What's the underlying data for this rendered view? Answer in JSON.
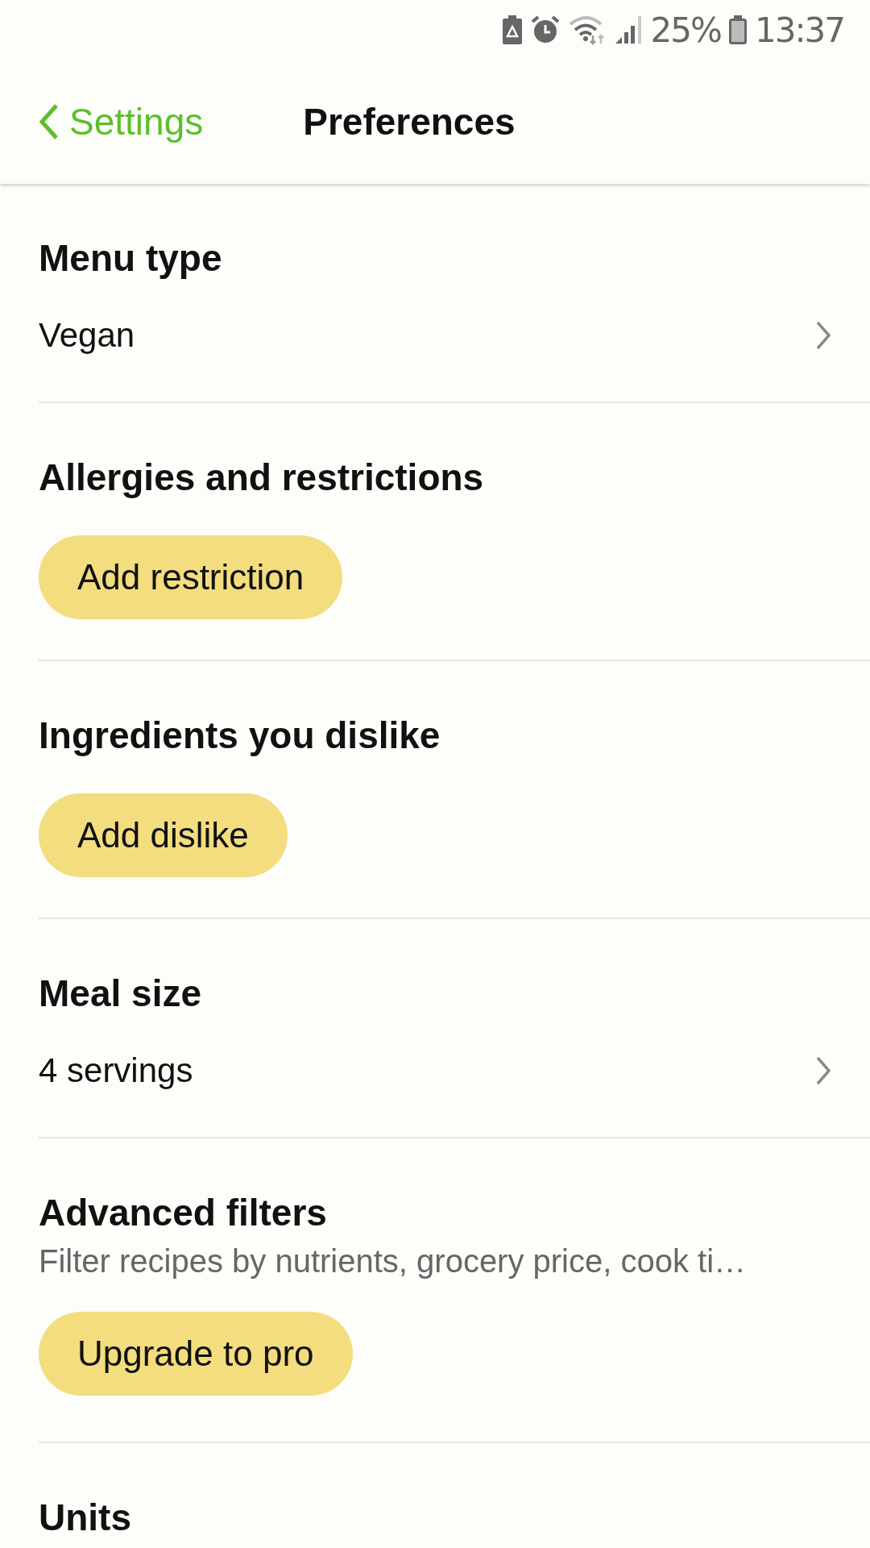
{
  "status_bar": {
    "battery_percent": "25%",
    "time": "13:37"
  },
  "header": {
    "back_label": "Settings",
    "title": "Preferences"
  },
  "sections": [
    {
      "kind": "select",
      "title": "Menu type",
      "value": "Vegan"
    },
    {
      "kind": "button",
      "title": "Allergies and restrictions",
      "button": "Add restriction"
    },
    {
      "kind": "button",
      "title": "Ingredients you dislike",
      "button": "Add dislike"
    },
    {
      "kind": "select",
      "title": "Meal size",
      "value": "4 servings"
    },
    {
      "kind": "filter",
      "title": "Advanced filters",
      "subtitle": "Filter recipes by nutrients, grocery price, cook ti…",
      "button": "Upgrade to pro"
    },
    {
      "kind": "heading",
      "title": "Units"
    }
  ]
}
